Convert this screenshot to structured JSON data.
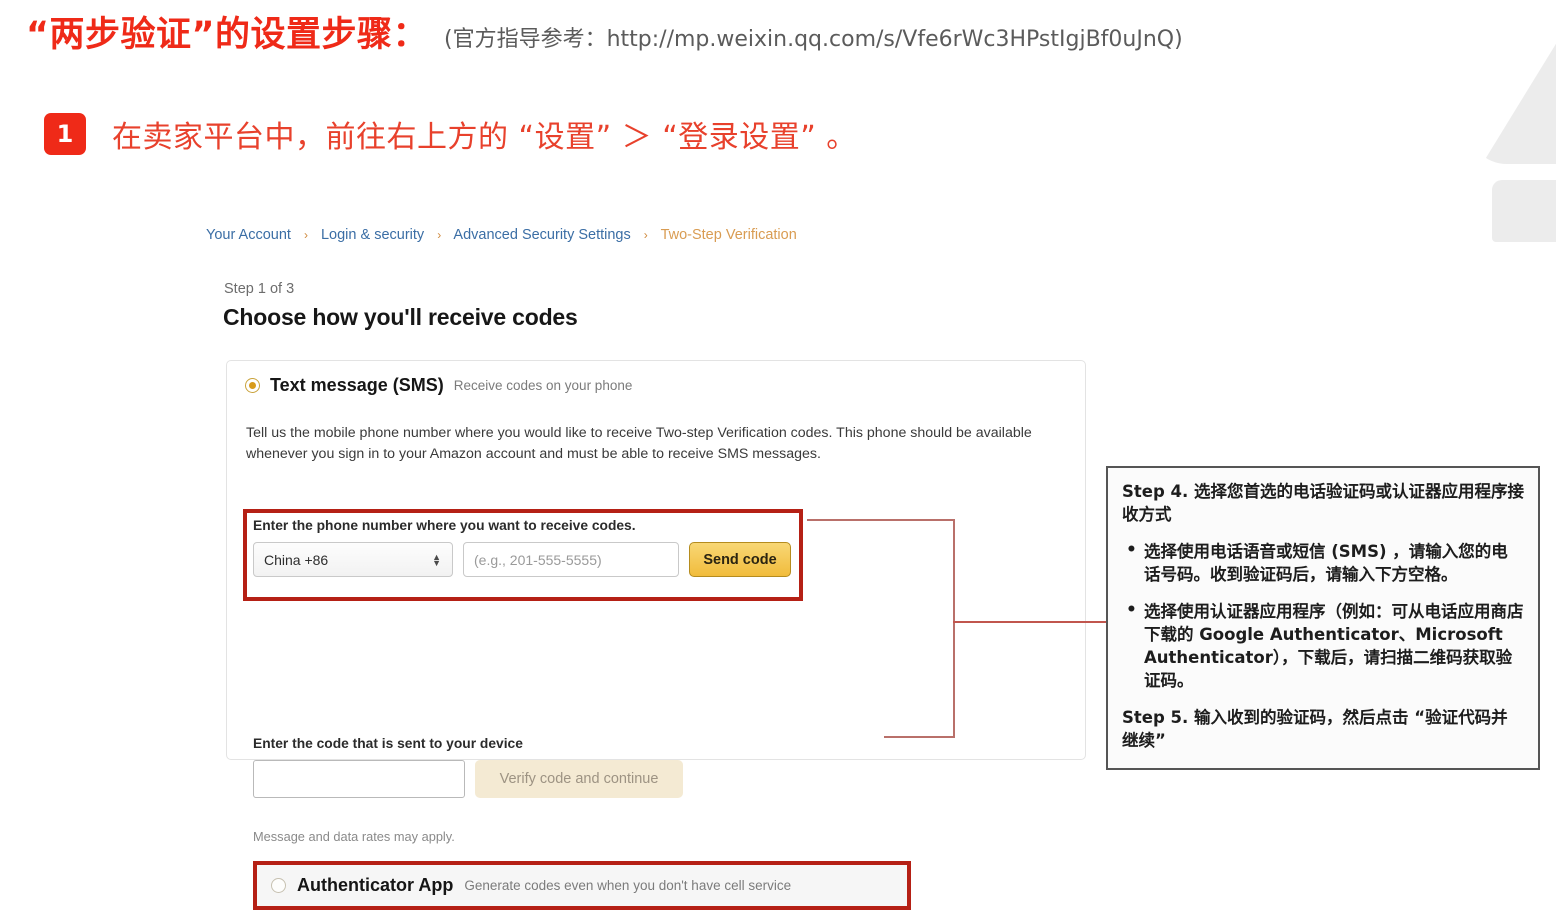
{
  "slide": {
    "title": "“两步验证”的设置步骤：",
    "reference": "(官方指导参考：http://mp.weixin.qq.com/s/Vfe6rWc3HPstIgjBf0uJnQ)",
    "step_badge": "1",
    "step_text": "在卖家平台中，前往右上方的 “设置” ＞ “登录设置” 。"
  },
  "amazon": {
    "breadcrumb": {
      "items": [
        "Your Account",
        "Login & security",
        "Advanced Security Settings",
        "Two-Step Verification"
      ],
      "separator": "›"
    },
    "step_label": "Step 1 of 3",
    "heading": "Choose how you'll receive codes",
    "sms": {
      "radio_state": "selected",
      "title": "Text message (SMS)",
      "subtitle": "Receive codes on your phone",
      "description": "Tell us the mobile phone number where you would like to receive Two-step Verification codes. This phone should be available whenever you sign in to your Amazon account and must be able to receive SMS messages.",
      "phone_label": "Enter the phone number where you want to receive codes.",
      "country_value": "China +86",
      "phone_placeholder": "(e.g., 201-555-5555)",
      "send_button": "Send code",
      "code_label": "Enter the code that is sent to your device",
      "code_value": "",
      "verify_button": "Verify code and continue",
      "rates_note": "Message and data rates may apply."
    },
    "authenticator": {
      "radio_state": "unselected",
      "title": "Authenticator App",
      "subtitle": "Generate codes even when you don't have cell service"
    }
  },
  "note_panel": {
    "step4": "Step 4. 选择您首选的电话验证码或认证器应用程序接收方式",
    "bullets": [
      "选择使用电话语音或短信 (SMS) ，请输入您的电话号码。收到验证码后，请输入下方空格。",
      "选择使用认证器应用程序（例如：可从电话应用商店下载的 Google Authenticator、Microsoft Authenticator），下载后，请扫描二维码获取验证码。"
    ],
    "step5": "Step 5. 输入收到的验证码，然后点击 “验证代码并继续”"
  },
  "colors": {
    "brand_red": "#ef2a18",
    "highlight_red": "#b52015",
    "amazon_gold": "#f1bc3c",
    "link_blue": "#3b6ea5",
    "crumb_current": "#d99c52"
  }
}
